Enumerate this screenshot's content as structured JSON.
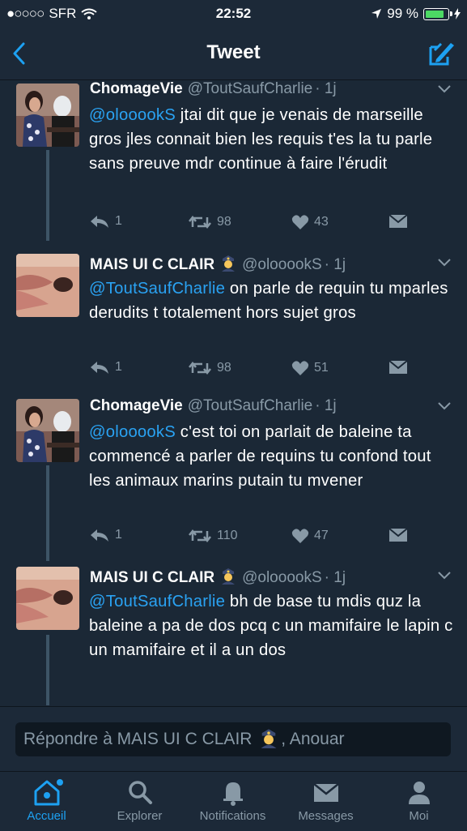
{
  "status_bar": {
    "carrier": "SFR",
    "time": "22:52",
    "battery": "99 %"
  },
  "nav": {
    "title": "Tweet"
  },
  "tweets": [
    {
      "name": "ChomageVie",
      "handle": "@ToutSaufCharlie",
      "time": "· 1j",
      "mention": "@olooookS",
      "text": " jtai dit que je venais de marseille gros jles connait bien les requis t'es la tu parle sans preuve mdr continue à faire l'érudit",
      "replies": "1",
      "retweets": "98",
      "likes": "43"
    },
    {
      "name": "MAIS UI C CLAIR",
      "handle": "@olooookS",
      "time": "· 1j",
      "mention": "@ToutSaufCharlie",
      "text": " on parle de requin tu mparles derudits t totalement hors sujet gros",
      "replies": "1",
      "retweets": "98",
      "likes": "51"
    },
    {
      "name": "ChomageVie",
      "handle": "@ToutSaufCharlie",
      "time": "· 1j",
      "mention": "@olooookS",
      "text": " c'est toi on parlait de baleine ta commencé a parler de requins tu confond tout les animaux marins putain tu mvener",
      "replies": "1",
      "retweets": "110",
      "likes": "47"
    },
    {
      "name": "MAIS UI C CLAIR",
      "handle": "@olooookS",
      "time": "· 1j",
      "mention": "@ToutSaufCharlie",
      "text": " bh de base tu mdis quz la baleine a pa de dos pcq c un mamifaire le lapin c un mamifaire et il a un dos"
    }
  ],
  "reply_bar": {
    "placeholder_prefix": "Répondre à MAIS UI C CLAIR",
    "placeholder_suffix": ", Anouar"
  },
  "tabs": [
    {
      "label": "Accueil",
      "icon": "home-icon",
      "active": true
    },
    {
      "label": "Explorer",
      "icon": "search-icon"
    },
    {
      "label": "Notifications",
      "icon": "bell-icon"
    },
    {
      "label": "Messages",
      "icon": "envelope-icon"
    },
    {
      "label": "Moi",
      "icon": "person-icon"
    }
  ],
  "colors": {
    "background": "#1b2836",
    "accent": "#1da1f2",
    "mention": "#2aa2f2",
    "muted": "#8899a6"
  }
}
